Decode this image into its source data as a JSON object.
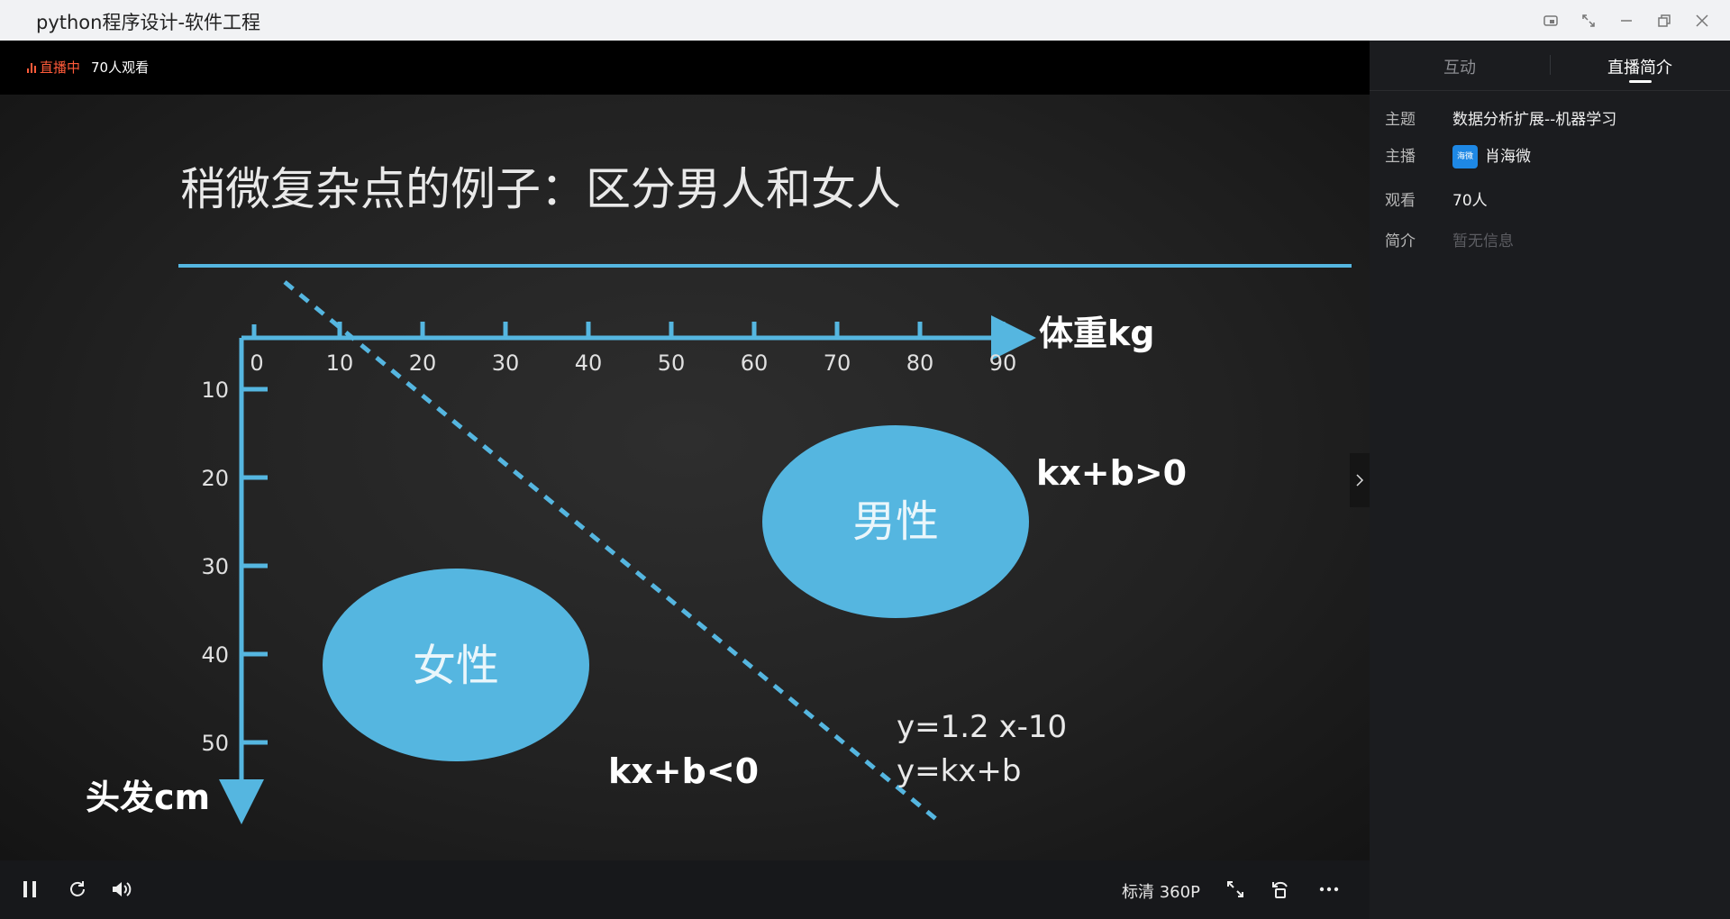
{
  "window": {
    "title": "python程序设计-软件工程",
    "controls": [
      "pin-icon",
      "fullscreen-icon",
      "minimize-icon",
      "restore-icon",
      "close-icon"
    ]
  },
  "live": {
    "status": "直播中",
    "viewers_text": "70人观看"
  },
  "slide": {
    "title": "稍微复杂点的例子：区分男人和女人",
    "x_axis_label": "体重kg",
    "y_axis_label": "头发cm",
    "x_ticks": [
      "0",
      "10",
      "20",
      "30",
      "40",
      "50",
      "60",
      "70",
      "80",
      "90"
    ],
    "y_ticks": [
      "10",
      "20",
      "30",
      "40",
      "50"
    ],
    "male_label": "男性",
    "female_label": "女性",
    "gt_label": "kx+b>0",
    "lt_label": "kx+b<0",
    "eq1": "y=1.2 x-10",
    "eq2": "y=kx+b"
  },
  "controls": {
    "quality": "标清 360P",
    "icons": [
      "pause-icon",
      "refresh-icon",
      "volume-icon",
      "fullscreen-icon",
      "rotate-icon",
      "more-icon"
    ]
  },
  "panel": {
    "tabs": [
      {
        "label": "互动",
        "active": false
      },
      {
        "label": "直播简介",
        "active": true
      }
    ],
    "info": {
      "topic_label": "主题",
      "topic": "数据分析扩展--机器学习",
      "host_label": "主播",
      "host_avatar_text": "海微",
      "host": "肖海微",
      "views_label": "观看",
      "views": "70人",
      "intro_label": "简介",
      "intro": "暂无信息"
    }
  },
  "colors": {
    "accent": "#55b6e0",
    "live": "#ff5b3a",
    "board": "#222222"
  }
}
